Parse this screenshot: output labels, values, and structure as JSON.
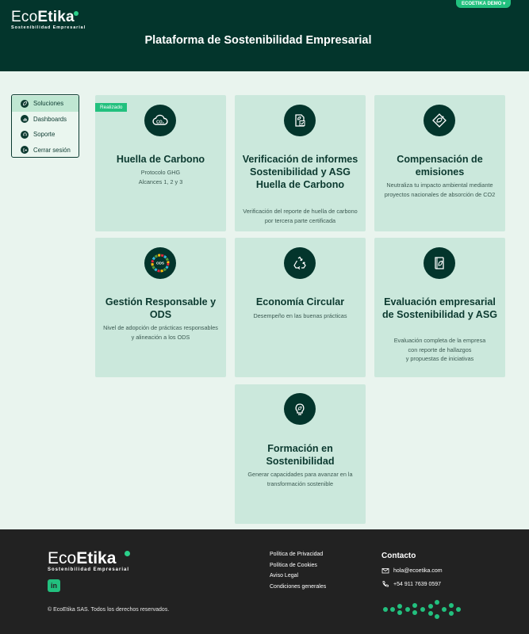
{
  "header": {
    "logo_word_light": "Eco",
    "logo_word_bold": "Etika",
    "logo_sub": "Sostenibilidad Empresarial",
    "demo_badge": "ECOETIKA DEMO ▾",
    "title": "Plataforma de Sostenibilidad Empresarial"
  },
  "sidebar": {
    "items": [
      {
        "label": "Soluciones",
        "icon": "leaf-icon"
      },
      {
        "label": "Dashboards",
        "icon": "chart-icon"
      },
      {
        "label": "Soporte",
        "icon": "headset-icon"
      },
      {
        "label": "Cerrar sesión",
        "icon": "logout-icon"
      }
    ]
  },
  "cards": [
    {
      "title": "Huella de Carbono",
      "desc": "Protocolo GHG\nAlcances 1, 2 y 3",
      "badge": "Realizado",
      "icon": "co2-cloud-icon"
    },
    {
      "title": "Verificación de informes Sostenibilidad y ASG Huella de Carbono",
      "desc": "Verificación del reporte de huella de carbono por tercera parte certificada",
      "icon": "document-verify-icon"
    },
    {
      "title": "Compensación de emisiones",
      "desc": "Neutraliza tu impacto ambiental mediante proyectos nacionales de absorción de CO2",
      "icon": "leaf-tag-icon"
    },
    {
      "title": "Gestión Responsable y ODS",
      "desc": "Nivel de adopción de prácticas responsables y alineación a los ODS",
      "icon": "ods-wheel-icon",
      "icon_text": "ODS"
    },
    {
      "title": "Economía Circular",
      "desc": "Desempeño en las buenas prácticas",
      "icon": "recycle-icon"
    },
    {
      "title": "Evaluación empresarial de Sostenibilidad y ASG",
      "desc": "Evaluación completa de la empresa\ncon reporte de hallazgos\ny propuestas de iniciativas",
      "icon": "leaf-book-icon"
    },
    {
      "title": "Formación en Sostenibilidad",
      "desc": "Generar capacidades para avanzar en la transformación sostenible",
      "icon": "lightbulb-icon"
    }
  ],
  "footer": {
    "logo_word_light": "Eco",
    "logo_word_bold": "Etika",
    "logo_sub": "Sostenibilidad Empresarial",
    "linkedin": "in",
    "copyright": "© EcoEtika SAS. Todos los derechos reservados.",
    "links": [
      "Política de Privacidad",
      "Política de Cookies",
      "Aviso Legal",
      "Condiciones generales"
    ],
    "contact_title": "Contacto",
    "email": "hola@ecoetika.com",
    "phone": "+54 911 7639 0597"
  },
  "colors": {
    "header_bg": "#03352c",
    "accent": "#22c07e",
    "card_bg": "#cbe8dc",
    "page_bg": "#e9f4ee",
    "footer_bg": "#222222"
  }
}
